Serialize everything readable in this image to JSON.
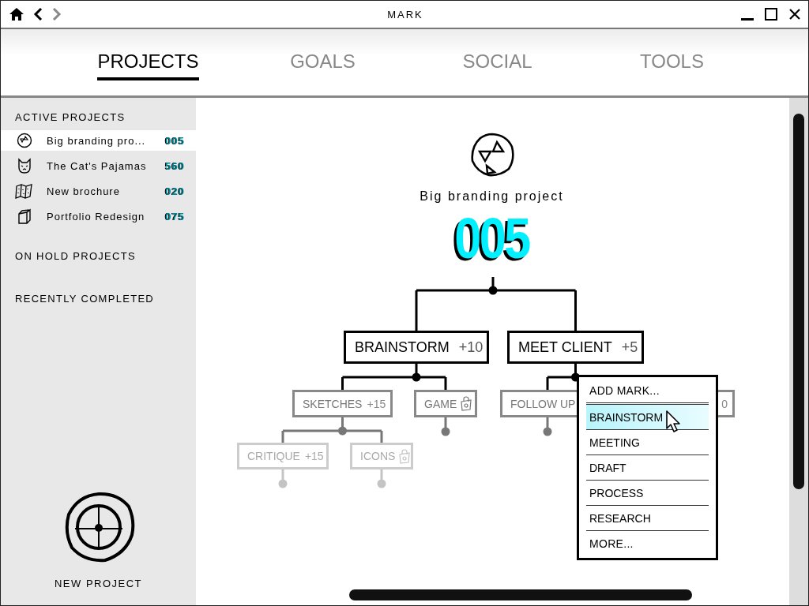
{
  "window": {
    "title": "MARK"
  },
  "tabs": [
    {
      "label": "PROJECTS",
      "selected": true
    },
    {
      "label": "GOALS",
      "selected": false
    },
    {
      "label": "SOCIAL",
      "selected": false
    },
    {
      "label": "TOOLS",
      "selected": false
    }
  ],
  "sidebar": {
    "sections": [
      {
        "heading": "ACTIVE PROJECTS",
        "items": [
          {
            "label": "Big branding pro...",
            "count": "005",
            "selected": true
          },
          {
            "label": "The Cat's Pajamas",
            "count": "560",
            "selected": false
          },
          {
            "label": "New brochure",
            "count": "020",
            "selected": false
          },
          {
            "label": "Portfolio Redesign",
            "count": "075",
            "selected": false
          }
        ]
      },
      {
        "heading": "ON HOLD PROJECTS"
      },
      {
        "heading": "RECENTLY COMPLETED"
      }
    ],
    "new_project": {
      "label": "NEW PROJECT"
    }
  },
  "project": {
    "title": "Big branding project",
    "count": "005",
    "tree": [
      {
        "label": "BRAINSTORM",
        "points": "+10",
        "children": [
          {
            "label": "SKETCHES",
            "points": "+15",
            "children": [
              {
                "label": "CRITIQUE",
                "points": "+15"
              },
              {
                "label": "ICONS",
                "locked": true
              }
            ]
          },
          {
            "label": "GAME",
            "locked": true
          }
        ]
      },
      {
        "label": "MEET CLIENT",
        "points": "+5",
        "children": [
          {
            "label": "FOLLOW UP"
          },
          {
            "points": "0"
          }
        ]
      }
    ]
  },
  "menu": {
    "items": [
      {
        "label": "ADD MARK...",
        "kind": "action",
        "selected": false
      },
      {
        "label": "BRAINSTORM",
        "kind": "mark",
        "selected": true
      },
      {
        "label": "MEETING",
        "kind": "mark",
        "selected": false
      },
      {
        "label": "DRAFT",
        "kind": "mark",
        "selected": false
      },
      {
        "label": "PROCESS",
        "kind": "mark",
        "selected": false
      },
      {
        "label": "RESEARCH",
        "kind": "mark",
        "selected": false
      },
      {
        "label": "MORE...",
        "kind": "action",
        "selected": false
      }
    ]
  }
}
